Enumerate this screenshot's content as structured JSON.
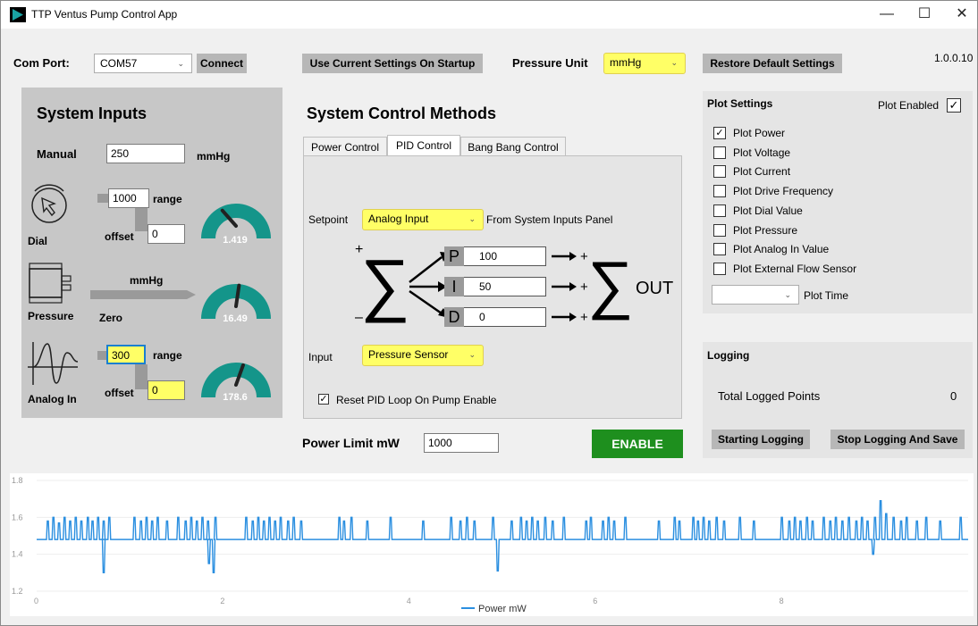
{
  "window": {
    "title": "TTP Ventus Pump Control App",
    "minimize": "—",
    "maximize": "☐",
    "close": "✕"
  },
  "toolbar": {
    "com_port_label": "Com Port:",
    "com_port_value": "COM57",
    "connect_label": "Connect",
    "use_current_label": "Use Current Settings On Startup",
    "pressure_unit_label": "Pressure Unit",
    "pressure_unit_value": "mmHg",
    "restore_label": "Restore Default Settings",
    "version": "1.0.0.10"
  },
  "system_inputs": {
    "title": "System Inputs",
    "manual_label": "Manual",
    "manual_value": "250",
    "manual_unit": "mmHg",
    "dial_label": "Dial",
    "dial_range_value": "1000",
    "dial_range_label": "range",
    "dial_offset_label": "offset",
    "dial_offset_value": "0",
    "dial_gauge_value": "1.419",
    "pressure_label": "Pressure",
    "pressure_unit": "mmHg",
    "zero_label": "Zero",
    "pressure_gauge_value": "16.49",
    "analog_label": "Analog In",
    "analog_range_value": "300",
    "analog_range_label": "range",
    "analog_offset_label": "offset",
    "analog_offset_value": "0",
    "analog_gauge_value": "178.6",
    "gauge_fractions": [
      0.25,
      0.55,
      0.62
    ]
  },
  "control": {
    "title": "System Control Methods",
    "tabs": [
      "Power Control",
      "PID Control",
      "Bang Bang Control"
    ],
    "active_tab": "PID Control",
    "setpoint_label": "Setpoint",
    "setpoint_value": "Analog Input",
    "setpoint_note": "From System Inputs Panel",
    "p_letter": "P",
    "p_value": "100",
    "i_letter": "I",
    "i_value": "50",
    "d_letter": "D",
    "d_value": "0",
    "plus": "+",
    "minus": "–",
    "out_label": "OUT",
    "sigma": "∑",
    "input_label": "Input",
    "input_value": "Pressure Sensor",
    "reset_label": "Reset PID Loop On Pump Enable",
    "reset_checked": "✓",
    "power_limit_label": "Power Limit mW",
    "power_limit_value": "1000",
    "enable_label": "ENABLE",
    "enable_color": "#1e8f1e"
  },
  "plot_settings": {
    "title": "Plot Settings",
    "enabled_label": "Plot Enabled",
    "enabled_check": "✓",
    "items": [
      {
        "label": "Plot Power",
        "check": "✓"
      },
      {
        "label": "Plot Voltage",
        "check": ""
      },
      {
        "label": "Plot Current",
        "check": ""
      },
      {
        "label": "Plot Drive Frequency",
        "check": ""
      },
      {
        "label": "Plot Dial Value",
        "check": ""
      },
      {
        "label": "Plot Pressure",
        "check": ""
      },
      {
        "label": "Plot Analog In Value",
        "check": ""
      },
      {
        "label": "Plot External Flow Sensor",
        "check": ""
      }
    ],
    "plot_time_label": "Plot Time"
  },
  "logging": {
    "title": "Logging",
    "total_label": "Total Logged Points",
    "total_value": "0",
    "start_label": "Starting Logging",
    "stop_label": "Stop Logging And Save"
  },
  "colors": {
    "gauge": "#14958a",
    "line": "#2b8fe0",
    "highlight": "#ffff66"
  },
  "chart_data": {
    "type": "line",
    "legend": "Power mW",
    "xlim": [
      0,
      10
    ],
    "ylim": [
      1.2,
      1.8
    ],
    "x_ticks": [
      "0",
      "2",
      "4",
      "6",
      "8"
    ],
    "y_ticks": [
      "1.2",
      "1.4",
      "1.6",
      "1.8"
    ],
    "baseline": 1.48,
    "up_spikes_x": [
      0.12,
      0.18,
      0.24,
      0.3,
      0.36,
      0.42,
      0.48,
      0.55,
      0.6,
      0.66,
      0.72,
      0.78,
      1.05,
      1.12,
      1.18,
      1.24,
      1.3,
      1.4,
      1.52,
      1.6,
      1.66,
      1.72,
      1.78,
      1.84,
      1.92,
      2.25,
      2.32,
      2.38,
      2.44,
      2.5,
      2.56,
      2.62,
      2.7,
      2.76,
      2.84,
      3.25,
      3.3,
      3.38,
      3.55,
      3.8,
      4.15,
      4.45,
      4.55,
      4.62,
      4.7,
      4.9,
      5.1,
      5.2,
      5.26,
      5.32,
      5.38,
      5.46,
      5.54,
      5.66,
      5.9,
      5.95,
      6.08,
      6.14,
      6.2,
      6.32,
      6.68,
      6.85,
      6.9,
      7.05,
      7.1,
      7.16,
      7.22,
      7.3,
      7.38,
      7.55,
      7.7,
      8.0,
      8.08,
      8.14,
      8.2,
      8.27,
      8.33,
      8.45,
      8.52,
      8.58,
      8.65,
      8.72,
      8.8,
      8.86,
      8.92,
      9.0,
      9.06,
      9.12,
      9.2,
      9.28,
      9.34,
      9.45,
      9.55,
      9.7,
      9.92
    ],
    "up_spikes_y": [
      1.58,
      1.6,
      1.57,
      1.6,
      1.58,
      1.6,
      1.58,
      1.6,
      1.58,
      1.6,
      1.58,
      1.6,
      1.6,
      1.58,
      1.6,
      1.58,
      1.6,
      1.58,
      1.6,
      1.58,
      1.6,
      1.58,
      1.6,
      1.58,
      1.6,
      1.6,
      1.58,
      1.6,
      1.58,
      1.6,
      1.58,
      1.6,
      1.58,
      1.6,
      1.58,
      1.6,
      1.58,
      1.6,
      1.58,
      1.6,
      1.58,
      1.6,
      1.58,
      1.6,
      1.58,
      1.6,
      1.58,
      1.6,
      1.58,
      1.6,
      1.58,
      1.6,
      1.58,
      1.6,
      1.58,
      1.6,
      1.58,
      1.6,
      1.58,
      1.6,
      1.58,
      1.6,
      1.58,
      1.6,
      1.58,
      1.6,
      1.58,
      1.6,
      1.58,
      1.6,
      1.58,
      1.6,
      1.58,
      1.6,
      1.58,
      1.6,
      1.58,
      1.6,
      1.58,
      1.6,
      1.58,
      1.6,
      1.58,
      1.6,
      1.58,
      1.6,
      1.69,
      1.62,
      1.6,
      1.58,
      1.6,
      1.58,
      1.6,
      1.58,
      1.6
    ],
    "down_spikes_x": [
      0.72,
      1.85,
      1.9,
      4.95,
      8.98
    ],
    "down_spikes_y": [
      1.3,
      1.35,
      1.3,
      1.31,
      1.4
    ]
  }
}
